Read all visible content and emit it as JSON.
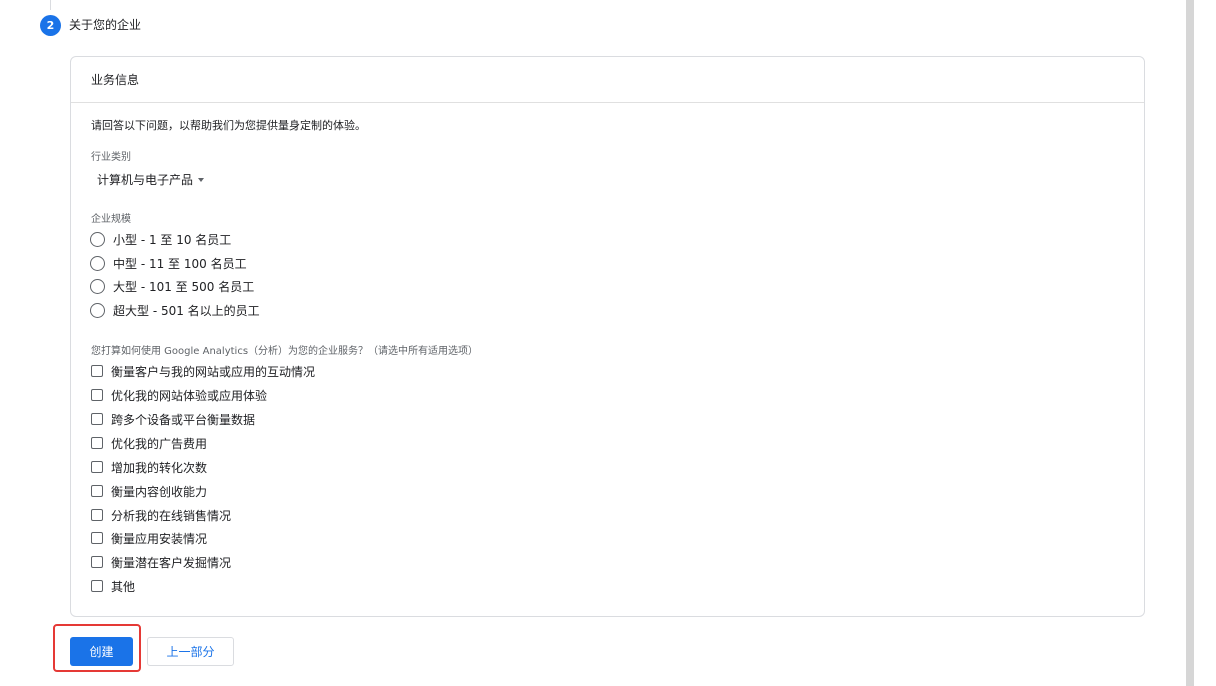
{
  "step": {
    "number": "2",
    "title": "关于您的企业"
  },
  "card": {
    "header": "业务信息",
    "intro": "请回答以下问题，以帮助我们为您提供量身定制的体验。",
    "industry": {
      "label": "行业类别",
      "selected": "计算机与电子产品"
    },
    "size": {
      "label": "企业规模",
      "options": [
        "小型 - 1 至 10 名员工",
        "中型 - 11 至 100 名员工",
        "大型 - 101 至 500 名员工",
        "超大型 - 501 名以上的员工"
      ]
    },
    "usage": {
      "label": "您打算如何使用 Google Analytics（分析）为您的企业服务？（请选中所有适用选项）",
      "options": [
        "衡量客户与我的网站或应用的互动情况",
        "优化我的网站体验或应用体验",
        "跨多个设备或平台衡量数据",
        "优化我的广告费用",
        "增加我的转化次数",
        "衡量内容创收能力",
        "分析我的在线销售情况",
        "衡量应用安装情况",
        "衡量潜在客户发掘情况",
        "其他"
      ]
    }
  },
  "buttons": {
    "create": "创建",
    "previous": "上一部分"
  },
  "colors": {
    "accent": "#1a73e8",
    "highlight": "#e53935"
  }
}
